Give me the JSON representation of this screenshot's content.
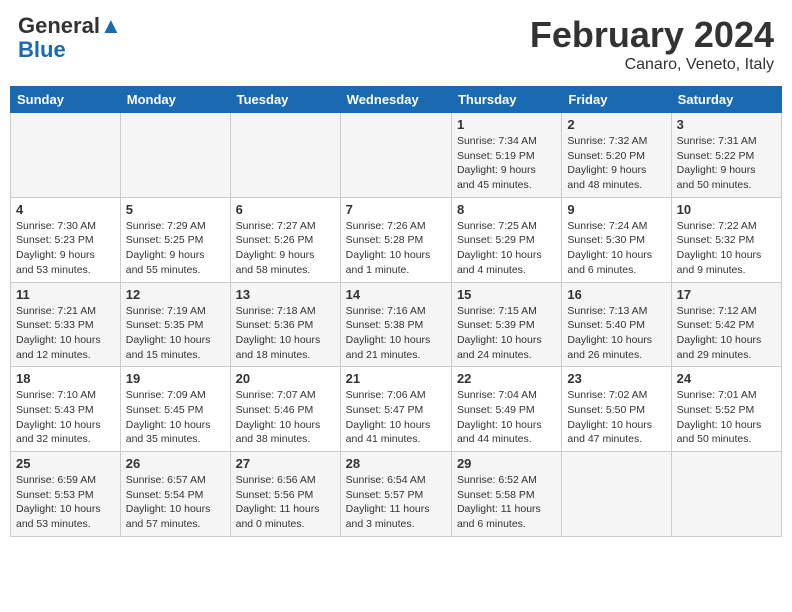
{
  "header": {
    "logo_line1": "General",
    "logo_line2": "Blue",
    "month_title": "February 2024",
    "location": "Canaro, Veneto, Italy"
  },
  "weekdays": [
    "Sunday",
    "Monday",
    "Tuesday",
    "Wednesday",
    "Thursday",
    "Friday",
    "Saturday"
  ],
  "weeks": [
    [
      {
        "day": "",
        "info": ""
      },
      {
        "day": "",
        "info": ""
      },
      {
        "day": "",
        "info": ""
      },
      {
        "day": "",
        "info": ""
      },
      {
        "day": "1",
        "info": "Sunrise: 7:34 AM\nSunset: 5:19 PM\nDaylight: 9 hours\nand 45 minutes."
      },
      {
        "day": "2",
        "info": "Sunrise: 7:32 AM\nSunset: 5:20 PM\nDaylight: 9 hours\nand 48 minutes."
      },
      {
        "day": "3",
        "info": "Sunrise: 7:31 AM\nSunset: 5:22 PM\nDaylight: 9 hours\nand 50 minutes."
      }
    ],
    [
      {
        "day": "4",
        "info": "Sunrise: 7:30 AM\nSunset: 5:23 PM\nDaylight: 9 hours\nand 53 minutes."
      },
      {
        "day": "5",
        "info": "Sunrise: 7:29 AM\nSunset: 5:25 PM\nDaylight: 9 hours\nand 55 minutes."
      },
      {
        "day": "6",
        "info": "Sunrise: 7:27 AM\nSunset: 5:26 PM\nDaylight: 9 hours\nand 58 minutes."
      },
      {
        "day": "7",
        "info": "Sunrise: 7:26 AM\nSunset: 5:28 PM\nDaylight: 10 hours\nand 1 minute."
      },
      {
        "day": "8",
        "info": "Sunrise: 7:25 AM\nSunset: 5:29 PM\nDaylight: 10 hours\nand 4 minutes."
      },
      {
        "day": "9",
        "info": "Sunrise: 7:24 AM\nSunset: 5:30 PM\nDaylight: 10 hours\nand 6 minutes."
      },
      {
        "day": "10",
        "info": "Sunrise: 7:22 AM\nSunset: 5:32 PM\nDaylight: 10 hours\nand 9 minutes."
      }
    ],
    [
      {
        "day": "11",
        "info": "Sunrise: 7:21 AM\nSunset: 5:33 PM\nDaylight: 10 hours\nand 12 minutes."
      },
      {
        "day": "12",
        "info": "Sunrise: 7:19 AM\nSunset: 5:35 PM\nDaylight: 10 hours\nand 15 minutes."
      },
      {
        "day": "13",
        "info": "Sunrise: 7:18 AM\nSunset: 5:36 PM\nDaylight: 10 hours\nand 18 minutes."
      },
      {
        "day": "14",
        "info": "Sunrise: 7:16 AM\nSunset: 5:38 PM\nDaylight: 10 hours\nand 21 minutes."
      },
      {
        "day": "15",
        "info": "Sunrise: 7:15 AM\nSunset: 5:39 PM\nDaylight: 10 hours\nand 24 minutes."
      },
      {
        "day": "16",
        "info": "Sunrise: 7:13 AM\nSunset: 5:40 PM\nDaylight: 10 hours\nand 26 minutes."
      },
      {
        "day": "17",
        "info": "Sunrise: 7:12 AM\nSunset: 5:42 PM\nDaylight: 10 hours\nand 29 minutes."
      }
    ],
    [
      {
        "day": "18",
        "info": "Sunrise: 7:10 AM\nSunset: 5:43 PM\nDaylight: 10 hours\nand 32 minutes."
      },
      {
        "day": "19",
        "info": "Sunrise: 7:09 AM\nSunset: 5:45 PM\nDaylight: 10 hours\nand 35 minutes."
      },
      {
        "day": "20",
        "info": "Sunrise: 7:07 AM\nSunset: 5:46 PM\nDaylight: 10 hours\nand 38 minutes."
      },
      {
        "day": "21",
        "info": "Sunrise: 7:06 AM\nSunset: 5:47 PM\nDaylight: 10 hours\nand 41 minutes."
      },
      {
        "day": "22",
        "info": "Sunrise: 7:04 AM\nSunset: 5:49 PM\nDaylight: 10 hours\nand 44 minutes."
      },
      {
        "day": "23",
        "info": "Sunrise: 7:02 AM\nSunset: 5:50 PM\nDaylight: 10 hours\nand 47 minutes."
      },
      {
        "day": "24",
        "info": "Sunrise: 7:01 AM\nSunset: 5:52 PM\nDaylight: 10 hours\nand 50 minutes."
      }
    ],
    [
      {
        "day": "25",
        "info": "Sunrise: 6:59 AM\nSunset: 5:53 PM\nDaylight: 10 hours\nand 53 minutes."
      },
      {
        "day": "26",
        "info": "Sunrise: 6:57 AM\nSunset: 5:54 PM\nDaylight: 10 hours\nand 57 minutes."
      },
      {
        "day": "27",
        "info": "Sunrise: 6:56 AM\nSunset: 5:56 PM\nDaylight: 11 hours\nand 0 minutes."
      },
      {
        "day": "28",
        "info": "Sunrise: 6:54 AM\nSunset: 5:57 PM\nDaylight: 11 hours\nand 3 minutes."
      },
      {
        "day": "29",
        "info": "Sunrise: 6:52 AM\nSunset: 5:58 PM\nDaylight: 11 hours\nand 6 minutes."
      },
      {
        "day": "",
        "info": ""
      },
      {
        "day": "",
        "info": ""
      }
    ]
  ]
}
